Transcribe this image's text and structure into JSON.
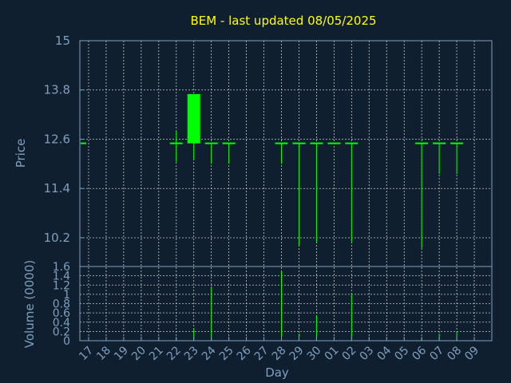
{
  "chart_data": [
    {
      "type": "candlestick",
      "title": "BEM - last updated 08/05/2025",
      "ylabel": "Price",
      "ylim": [
        9.5,
        15
      ],
      "yticks": [
        "10.2",
        "11.4",
        "12.6",
        "13.8",
        "15"
      ],
      "grid": true,
      "candle_color": "#00ff00",
      "candles": [
        {
          "date": "16",
          "open": 12.5,
          "high": 12.5,
          "low": 12.5,
          "close": 12.5
        },
        {
          "date": "22",
          "open": 12.5,
          "high": 12.8,
          "low": 12.05,
          "close": 12.5
        },
        {
          "date": "23",
          "open": 12.5,
          "high": 13.7,
          "low": 12.1,
          "close": 13.7
        },
        {
          "date": "24",
          "open": 12.5,
          "high": 12.5,
          "low": 12.0,
          "close": 12.5
        },
        {
          "date": "25",
          "open": 12.5,
          "high": 12.5,
          "low": 12.0,
          "close": 12.5
        },
        {
          "date": "28",
          "open": 12.5,
          "high": 12.5,
          "low": 12.0,
          "close": 12.5
        },
        {
          "date": "29",
          "open": 12.5,
          "high": 12.5,
          "low": 10.0,
          "close": 12.5
        },
        {
          "date": "30",
          "open": 12.5,
          "high": 12.5,
          "low": 10.1,
          "close": 12.5
        },
        {
          "date": "01",
          "open": 12.5,
          "high": 12.5,
          "low": 12.5,
          "close": 12.5
        },
        {
          "date": "02",
          "open": 12.5,
          "high": 12.5,
          "low": 10.1,
          "close": 12.5
        },
        {
          "date": "06",
          "open": 12.5,
          "high": 12.5,
          "low": 9.95,
          "close": 12.5
        },
        {
          "date": "07",
          "open": 12.5,
          "high": 12.5,
          "low": 11.75,
          "close": 12.5
        },
        {
          "date": "08",
          "open": 12.5,
          "high": 12.5,
          "low": 11.75,
          "close": 12.5
        }
      ]
    },
    {
      "type": "bar",
      "ylabel": "Volume (0000)",
      "xlabel": "Day",
      "ylim": [
        0,
        1.6
      ],
      "yticks": [
        "0",
        "0.2",
        "0.4",
        "0.6",
        "0.8",
        "1",
        "1.2",
        "1.4",
        "1.6"
      ],
      "grid": true,
      "bar_color": "#00ff00",
      "categories": [
        "17",
        "18",
        "19",
        "20",
        "21",
        "22",
        "23",
        "24",
        "25",
        "26",
        "27",
        "28",
        "29",
        "30",
        "01",
        "02",
        "03",
        "04",
        "05",
        "06",
        "07",
        "08",
        "09"
      ],
      "values": [
        0,
        0,
        0,
        0,
        0,
        0.05,
        0.25,
        1.15,
        0,
        0,
        0,
        1.5,
        0.15,
        0.55,
        0,
        1.0,
        0,
        0,
        0,
        0.05,
        0.15,
        0.2,
        0
      ]
    }
  ]
}
